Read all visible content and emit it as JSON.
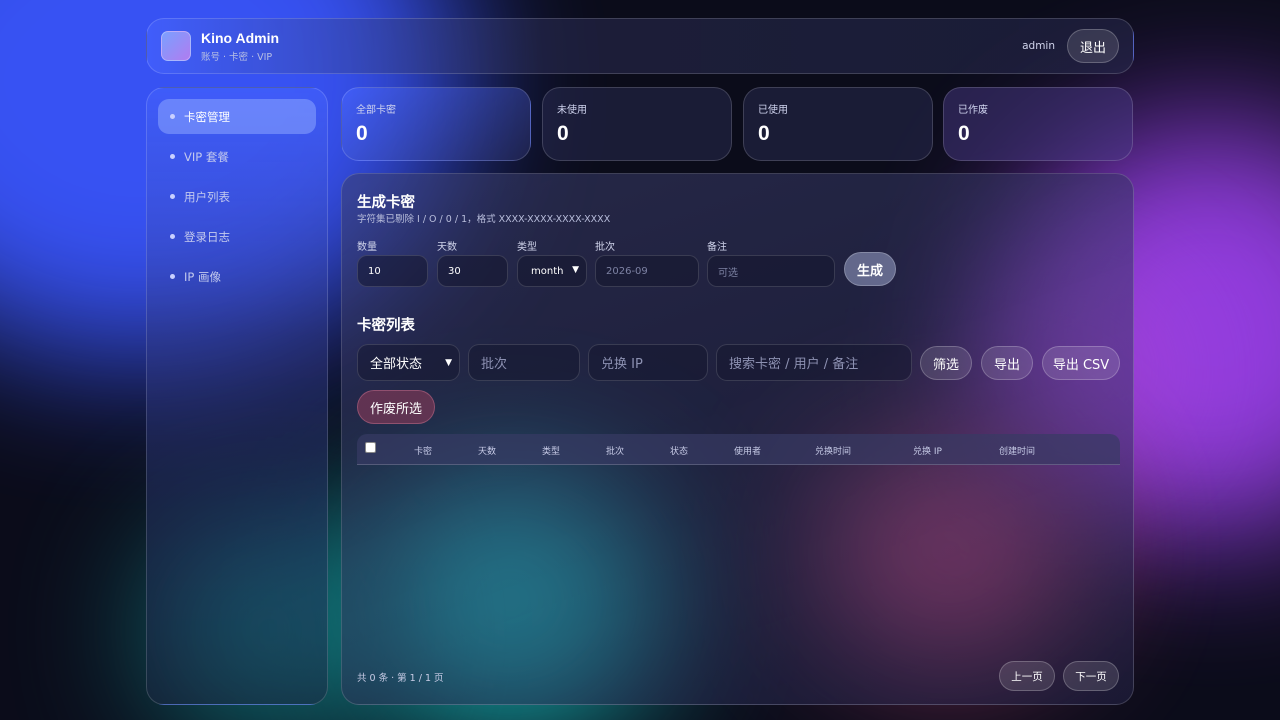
{
  "app": {
    "title": "Kino Admin",
    "subtitle": "账号 · 卡密 · VIP",
    "user": "admin",
    "logout_label": "退出"
  },
  "sidebar": {
    "items": [
      {
        "label": "卡密管理",
        "active": true
      },
      {
        "label": "VIP 套餐",
        "active": false
      },
      {
        "label": "用户列表",
        "active": false
      },
      {
        "label": "登录日志",
        "active": false
      },
      {
        "label": "IP 画像",
        "active": false
      }
    ]
  },
  "stats": [
    {
      "label": "全部卡密",
      "value": "0"
    },
    {
      "label": "未使用",
      "value": "0"
    },
    {
      "label": "已使用",
      "value": "0"
    },
    {
      "label": "已作废",
      "value": "0"
    }
  ],
  "generate": {
    "title": "生成卡密",
    "subtitle": "字符集已剔除 I / O / 0 / 1，格式 XXXX-XXXX-XXXX-XXXX",
    "fields": {
      "quantity": {
        "label": "数量",
        "value": "10"
      },
      "days": {
        "label": "天数",
        "value": "30"
      },
      "type": {
        "label": "类型",
        "value": "month"
      },
      "batch": {
        "label": "批次",
        "placeholder": "2026-09"
      },
      "note": {
        "label": "备注",
        "placeholder": "可选"
      }
    },
    "button_label": "生成"
  },
  "list": {
    "title": "卡密列表",
    "status_filter": "全部状态",
    "batch_placeholder": "批次",
    "ip_placeholder": "兑换 IP",
    "search_placeholder": "搜索卡密 / 用户 / 备注",
    "filter_label": "筛选",
    "export_label": "导出",
    "export_csv_label": "导出 CSV",
    "void_selected_label": "作废所选",
    "columns": [
      "卡密",
      "天数",
      "类型",
      "批次",
      "状态",
      "使用者",
      "兑换时间",
      "兑换 IP",
      "创建时间"
    ],
    "rows": []
  },
  "pagination": {
    "summary": "共 0 条 · 第 1 / 1 页",
    "prev_label": "上一页",
    "next_label": "下一页"
  }
}
